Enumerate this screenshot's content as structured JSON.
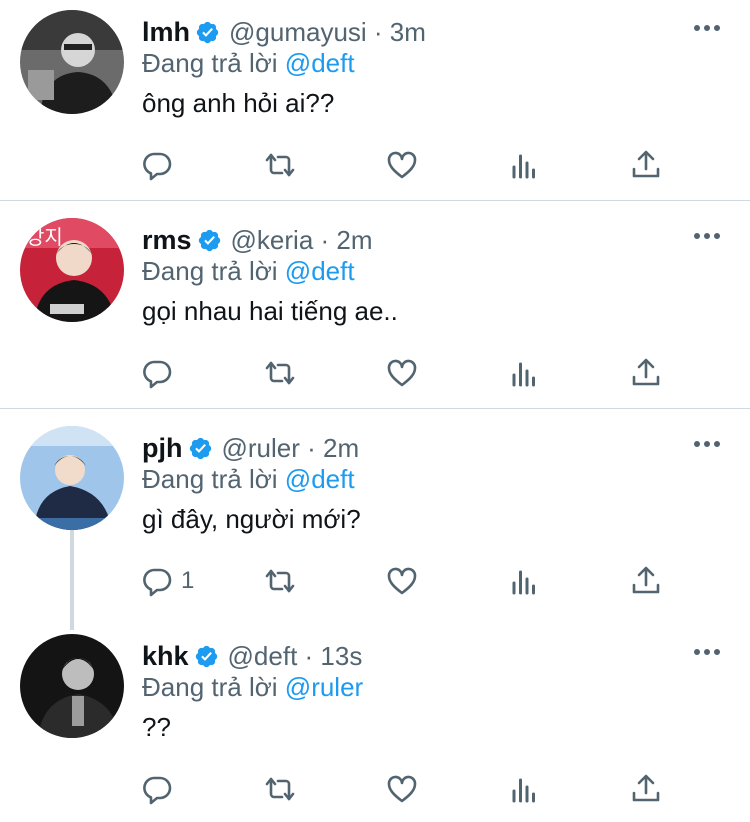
{
  "tweets": [
    {
      "name": "lmh",
      "handle": "@gumayusi · 3m",
      "reply_prefix": "Đang trả lời",
      "reply_to": "@deft",
      "text": "ông anh hỏi ai??",
      "reply_count": ""
    },
    {
      "name": "rms",
      "handle": "@keria · 2m",
      "reply_prefix": "Đang trả lời",
      "reply_to": "@deft",
      "text": "gọi nhau hai tiếng ae..",
      "reply_count": ""
    },
    {
      "name": "pjh",
      "handle": "@ruler · 2m",
      "reply_prefix": "Đang trả lời",
      "reply_to": "@deft",
      "text": "gì đây, người mới?",
      "reply_count": "1"
    },
    {
      "name": "khk",
      "handle": "@deft · 13s",
      "reply_prefix": "Đang trả lời",
      "reply_to": "@ruler",
      "text": "??",
      "reply_count": ""
    }
  ],
  "icons": {
    "reply": "reply-icon",
    "retweet": "retweet-icon",
    "like": "heart-icon",
    "stats": "analytics-icon",
    "share": "share-icon",
    "more": "more-icon",
    "verified": "verified-badge-icon"
  },
  "colors": {
    "accent": "#1d9bf0",
    "secondary_text": "#536471",
    "primary_text": "#0f1419",
    "divider": "#cfd9de"
  }
}
